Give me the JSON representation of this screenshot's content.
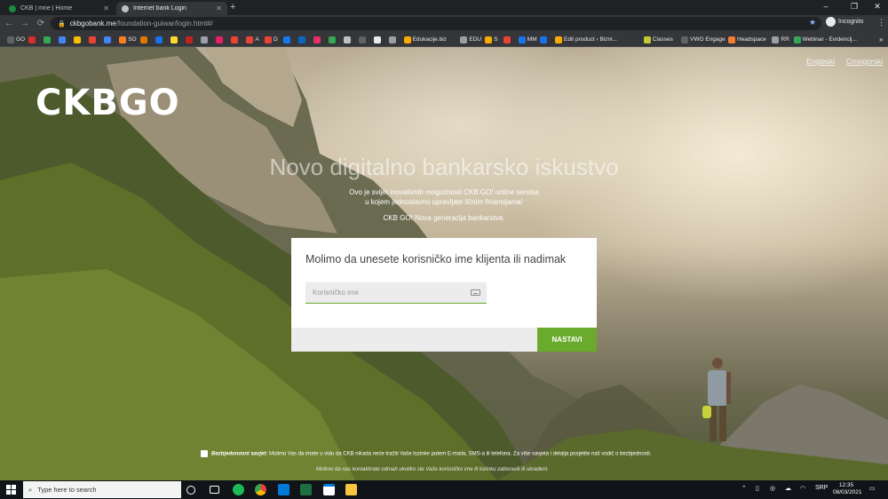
{
  "browser": {
    "tabs": [
      {
        "title": "CKB | mne | Home",
        "active": false,
        "favicon_color": "#1a8a3c"
      },
      {
        "title": "Internet bank Login",
        "active": true,
        "favicon_color": "#bdc1c6"
      }
    ],
    "new_tab": "+",
    "window_controls": {
      "minimize": "–",
      "restore": "❐",
      "close": "✕"
    },
    "nav": {
      "back": "←",
      "forward": "→",
      "reload": "⟳"
    },
    "url": {
      "host": "ckbgobank.me",
      "path": "/foundation-guiwar/login.html#/"
    },
    "profile": "Incognito",
    "menu_icon": "⋮",
    "bookmarks": [
      {
        "label": "GO",
        "color": "#5f6368"
      },
      {
        "label": "",
        "color": "#d93025"
      },
      {
        "label": "",
        "color": "#34a853"
      },
      {
        "label": "",
        "color": "#4285f4"
      },
      {
        "label": "",
        "color": "#fbbc04"
      },
      {
        "label": "",
        "color": "#ea4335"
      },
      {
        "label": "",
        "color": "#4285f4"
      },
      {
        "label": "SO",
        "color": "#f48024"
      },
      {
        "label": "",
        "color": "#e37400"
      },
      {
        "label": "",
        "color": "#1a73e8"
      },
      {
        "label": "",
        "color": "#fdd835"
      },
      {
        "label": "",
        "color": "#c5221f"
      },
      {
        "label": "",
        "color": "#9aa0a6"
      },
      {
        "label": "",
        "color": "#e91e63"
      },
      {
        "label": "",
        "color": "#ea4335"
      },
      {
        "label": "A",
        "color": "#ea4335"
      },
      {
        "label": "D",
        "color": "#ea4335"
      },
      {
        "label": "",
        "color": "#1877f2"
      },
      {
        "label": "",
        "color": "#0a66c2"
      },
      {
        "label": "",
        "color": "#e1306c"
      },
      {
        "label": "",
        "color": "#34a853"
      },
      {
        "label": "",
        "color": "#bdc1c6"
      },
      {
        "label": "",
        "color": "#5f6368"
      },
      {
        "label": "",
        "color": "#e8eaed"
      },
      {
        "label": "",
        "color": "#9aa0a6"
      },
      {
        "label": "Edukacije.biz",
        "color": "#f9ab00"
      },
      {
        "label": "EDU",
        "color": "#9aa0a6"
      },
      {
        "label": "S",
        "color": "#f9ab00"
      },
      {
        "label": "",
        "color": "#ea4335"
      },
      {
        "label": "MM",
        "color": "#1a73e8"
      },
      {
        "label": "",
        "color": "#1a73e8"
      },
      {
        "label": "Edit product ‹ Bizni...",
        "color": "#f9ab00"
      },
      {
        "label": "Classes",
        "color": "#c0ca33"
      },
      {
        "label": "VWO Engage",
        "color": "#5f6368"
      },
      {
        "label": "Headspace",
        "color": "#f47d31"
      },
      {
        "label": "RR",
        "color": "#9aa0a6"
      },
      {
        "label": "Webinar - Evidencij...",
        "color": "#34a853"
      }
    ],
    "bookmarks_more": "»"
  },
  "page": {
    "lang_english": "Engleski",
    "lang_montenegrin": "Crnogorski",
    "logo_text": "CKBGO",
    "hero_title": "Novo digitalno bankarsko iskustvo",
    "hero_sub_line1": "Ovo je svijet inovativnih mogućnosti CKB GO! online servisa",
    "hero_sub_line2": "u kojem jednostavno upravljate ličnim finansijama!",
    "hero_tagline": "CKB GO! Nova generacija bankarstva.",
    "login": {
      "title": "Molimo da unesete korisničko ime klijenta ili nadimak",
      "username_placeholder": "Korisničko ime",
      "username_value": "",
      "submit_label": "NASTAVI"
    },
    "notice_title": "Bezbjedonosni savjet:",
    "notice_text": "Molimo Vas da imate u vidu da CKB nikada neće tražiti Vaše lozinke putem E-maila, SMS-a ili telefona. Za više savjeta i detalja posjetite naš vodič o bezbjednosti.",
    "notice_text2": "Molimo da nas kontaktirate odmah ukoliko ste Vaše korisničko ime ili lozinku zaboravili ili ukradeni."
  },
  "taskbar": {
    "search_placeholder": "Type here to search",
    "apps": [
      {
        "name": "task-view",
        "color": "#ffffff"
      },
      {
        "name": "spotify",
        "color": "#1db954"
      },
      {
        "name": "chrome",
        "color": "#fbbc04"
      },
      {
        "name": "media-player",
        "color": "#0078d7"
      },
      {
        "name": "excel",
        "color": "#1d6f42"
      },
      {
        "name": "app",
        "color": "#0078d7"
      },
      {
        "name": "explorer",
        "color": "#f9c53f"
      }
    ],
    "language": "SRP",
    "time": "12:35",
    "date": "08/03/2021"
  }
}
